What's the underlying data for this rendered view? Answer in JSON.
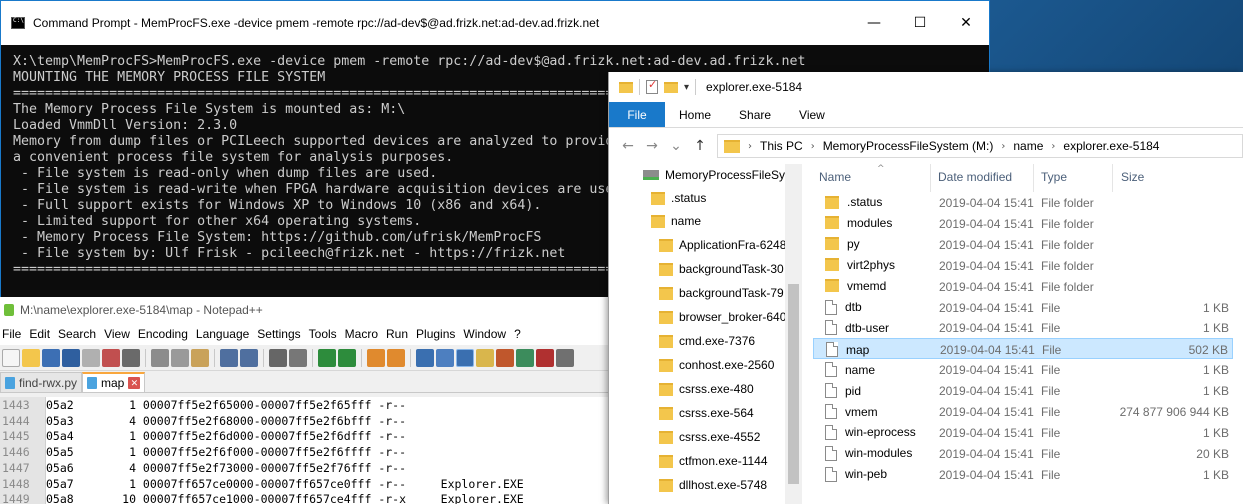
{
  "cmd": {
    "title": "Command Prompt - MemProcFS.exe  -device pmem -remote rpc://ad-dev$@ad.frizk.net:ad-dev.ad.frizk.net",
    "controls": {
      "minimize": "—",
      "maximize": "☐",
      "close": "✕"
    },
    "lines": [
      "X:\\temp\\MemProcFS>MemProcFS.exe -device pmem -remote rpc://ad-dev$@ad.frizk.net:ad-dev.ad.frizk.net",
      "MOUNTING THE MEMORY PROCESS FILE SYSTEM",
      "===============================================================================================================",
      "The Memory Process File System is mounted as: M:\\",
      "Loaded VmmDll Version: 2.3.0",
      "Memory from dump files or PCILeech supported devices are analyzed to provide",
      "a convenient process file system for analysis purposes.",
      " - File system is read-only when dump files are used.",
      " - File system is read-write when FPGA hardware acquisition devices are used.",
      " - Full support exists for Windows XP to Windows 10 (x86 and x64).",
      " - Limited support for other x64 operating systems.",
      " - Memory Process File System: https://github.com/ufrisk/MemProcFS",
      " - File system by: Ulf Frisk - pcileech@frizk.net - https://frizk.net",
      "==============================================================================================================="
    ]
  },
  "notepad": {
    "title": "M:\\name\\explorer.exe-5184\\map - Notepad++",
    "menu": [
      "File",
      "Edit",
      "Search",
      "View",
      "Encoding",
      "Language",
      "Settings",
      "Tools",
      "Macro",
      "Run",
      "Plugins",
      "Window",
      "?"
    ],
    "tabs": [
      {
        "label": "find-rwx.py",
        "active": false
      },
      {
        "label": "map",
        "active": true
      }
    ],
    "tab_close": "✕",
    "lines": [
      {
        "num": "1443",
        "text": "05a2        1 00007ff5e2f65000-00007ff5e2f65fff -r--"
      },
      {
        "num": "1444",
        "text": "05a3        4 00007ff5e2f68000-00007ff5e2f6bfff -r--"
      },
      {
        "num": "1445",
        "text": "05a4        1 00007ff5e2f6d000-00007ff5e2f6dfff -r--"
      },
      {
        "num": "1446",
        "text": "05a5        1 00007ff5e2f6f000-00007ff5e2f6ffff -r--"
      },
      {
        "num": "1447",
        "text": "05a6        4 00007ff5e2f73000-00007ff5e2f76fff -r--"
      },
      {
        "num": "1448",
        "text": "05a7        1 00007ff657ce0000-00007ff657ce0fff -r--     Explorer.EXE"
      },
      {
        "num": "1449",
        "text": "05a8       10 00007ff657ce1000-00007ff657ce4fff -r-x     Explorer.EXE"
      }
    ]
  },
  "explorer": {
    "title": "explorer.exe-5184",
    "qa_down": "▾",
    "ribbon": {
      "file": "File",
      "tabs": [
        "Home",
        "Share",
        "View"
      ]
    },
    "nav_arrows": {
      "back": "←",
      "forward": "→",
      "recent": "⌄",
      "up": "↑"
    },
    "breadcrumb": [
      "This PC",
      "MemoryProcessFileSystem (M:)",
      "name",
      "explorer.exe-5184"
    ],
    "breadcrumb_sep": "›",
    "nav_pane": {
      "drive": "MemoryProcessFileSys",
      "items": [
        ".status",
        "name"
      ],
      "children": [
        "ApplicationFra-6248",
        "backgroundTask-30",
        "backgroundTask-79",
        "browser_broker-640",
        "cmd.exe-7376",
        "conhost.exe-2560",
        "csrss.exe-480",
        "csrss.exe-564",
        "csrss.exe-4552",
        "ctfmon.exe-1144",
        "dllhost.exe-5748"
      ]
    },
    "columns": {
      "name": "Name",
      "date": "Date modified",
      "type": "Type",
      "size": "Size"
    },
    "sort_arrow": "^",
    "files": [
      {
        "name": ".status",
        "date": "2019-04-04 15:41",
        "type": "File folder",
        "size": "",
        "kind": "folder"
      },
      {
        "name": "modules",
        "date": "2019-04-04 15:41",
        "type": "File folder",
        "size": "",
        "kind": "folder"
      },
      {
        "name": "py",
        "date": "2019-04-04 15:41",
        "type": "File folder",
        "size": "",
        "kind": "folder"
      },
      {
        "name": "virt2phys",
        "date": "2019-04-04 15:41",
        "type": "File folder",
        "size": "",
        "kind": "folder"
      },
      {
        "name": "vmemd",
        "date": "2019-04-04 15:41",
        "type": "File folder",
        "size": "",
        "kind": "folder"
      },
      {
        "name": "dtb",
        "date": "2019-04-04 15:41",
        "type": "File",
        "size": "1 KB",
        "kind": "file"
      },
      {
        "name": "dtb-user",
        "date": "2019-04-04 15:41",
        "type": "File",
        "size": "1 KB",
        "kind": "file"
      },
      {
        "name": "map",
        "date": "2019-04-04 15:41",
        "type": "File",
        "size": "502 KB",
        "kind": "file",
        "selected": true
      },
      {
        "name": "name",
        "date": "2019-04-04 15:41",
        "type": "File",
        "size": "1 KB",
        "kind": "file"
      },
      {
        "name": "pid",
        "date": "2019-04-04 15:41",
        "type": "File",
        "size": "1 KB",
        "kind": "file"
      },
      {
        "name": "vmem",
        "date": "2019-04-04 15:41",
        "type": "File",
        "size": "274 877 906 944 KB",
        "kind": "file"
      },
      {
        "name": "win-eprocess",
        "date": "2019-04-04 15:41",
        "type": "File",
        "size": "1 KB",
        "kind": "file"
      },
      {
        "name": "win-modules",
        "date": "2019-04-04 15:41",
        "type": "File",
        "size": "20 KB",
        "kind": "file"
      },
      {
        "name": "win-peb",
        "date": "2019-04-04 15:41",
        "type": "File",
        "size": "1 KB",
        "kind": "file"
      }
    ]
  },
  "colors": {
    "accent": "#1979ca",
    "selection": "#cce8ff",
    "folder": "#f3c64c",
    "console_bg": "#0c0c0c",
    "console_fg": "#cccccc"
  }
}
